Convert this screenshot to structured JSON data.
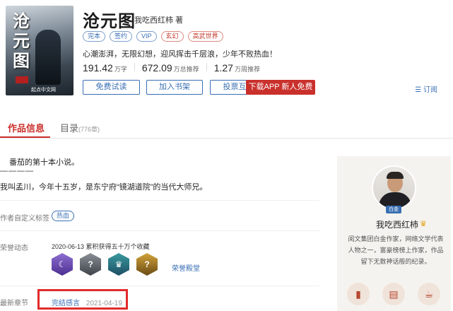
{
  "book": {
    "cover_title": "沧元图",
    "cover_publisher": "起点中文网",
    "title": "沧元图",
    "author": "我吃西红柿 著",
    "tags": [
      "完本",
      "签约",
      "VIP",
      "玄幻",
      "高武世界"
    ],
    "intro": "心潮澎湃，无限幻想，迎风挥击千层浪，少年不败热血！",
    "stats": [
      {
        "value": "191.42",
        "unit": "万字"
      },
      {
        "value": "672.09",
        "unit": "万总推荐"
      },
      {
        "value": "1.27",
        "unit": "万周推荐"
      }
    ]
  },
  "actions": {
    "read_free": "免费试读",
    "add_shelf": "加入书架",
    "vote": "投票互动",
    "download": "下载APP 新人免费读",
    "subscribe": "订阅"
  },
  "tabs": {
    "info": "作品信息",
    "catalog": "目录",
    "catalog_count": "(776章)"
  },
  "content": {
    "desc1": "番茄的第十本小说。",
    "dash": "————",
    "desc2": "我叫孟川，今年十五岁，是东宁府“镜湖道院”的当代大师兄。",
    "custom_tags_label": "作者自定义标签",
    "custom_tag": "热血",
    "honor_label": "荣誉动态",
    "honor_text": "2020-06-13  累积获得五十万个收藏",
    "honor_hall": "荣誉殿堂",
    "latest_label": "最新章节",
    "latest_chapter": "完结感言",
    "latest_date": "2021-04-19"
  },
  "author_panel": {
    "badge": "白金",
    "name": "我吃西红柿",
    "desc": "阅文集团白金作家，网络文学代表人物之一，富豪榜榜上作家，作品留下无数神话般的纪录。"
  },
  "colors": {
    "accent_red": "#c9302c",
    "link_blue": "#3a6fb3",
    "highlight_box": "#e12b2b"
  }
}
